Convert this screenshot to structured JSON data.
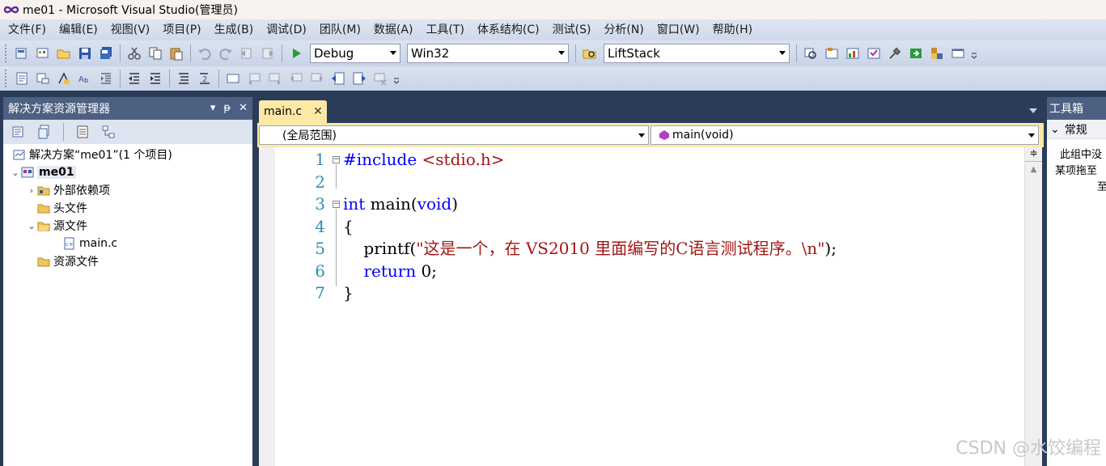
{
  "window": {
    "title": "me01 - Microsoft Visual Studio(管理员)"
  },
  "menu": [
    "文件(F)",
    "编辑(E)",
    "视图(V)",
    "项目(P)",
    "生成(B)",
    "调试(D)",
    "团队(M)",
    "数据(A)",
    "工具(T)",
    "体系结构(C)",
    "测试(S)",
    "分析(N)",
    "窗口(W)",
    "帮助(H)"
  ],
  "toolbar": {
    "config": "Debug",
    "platform": "Win32",
    "find": "LiftStack"
  },
  "solution_explorer": {
    "title": "解决方案资源管理器",
    "items": [
      {
        "label": "解决方案“me01”(1 个项目)"
      },
      {
        "label": "me01"
      },
      {
        "label": "外部依赖项"
      },
      {
        "label": "头文件"
      },
      {
        "label": "源文件"
      },
      {
        "label": "main.c"
      },
      {
        "label": "资源文件"
      }
    ]
  },
  "editor": {
    "tab_label": "main.c",
    "scope_combo": "(全局范围)",
    "member_combo": "main(void)",
    "line_numbers": [
      "1",
      "2",
      "3",
      "4",
      "5",
      "6",
      "7"
    ]
  },
  "toolbox": {
    "title": "工具箱",
    "group": "常规",
    "empty_text_1": "此组中没",
    "empty_text_2": "某项拖至",
    "empty_text_3": "至"
  },
  "watermark": "CSDN @水饺编程"
}
